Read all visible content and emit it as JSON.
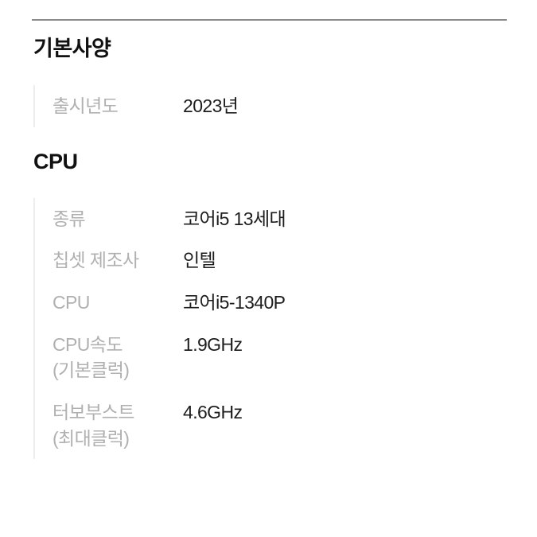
{
  "divider": {
    "name": "top-divider",
    "color": "#8a8a8a"
  },
  "colors": {
    "background": "#ffffff",
    "heading": "#111111",
    "label": "#b0b0b0",
    "value": "#1d1d1d",
    "rule": "#ededed"
  },
  "sections": [
    {
      "title": "기본사양",
      "rows": [
        {
          "label": "출시년도",
          "value": "2023년"
        }
      ]
    },
    {
      "title": "CPU",
      "rows": [
        {
          "label": "종류",
          "value": "코어i5 13세대"
        },
        {
          "label": "칩셋 제조사",
          "value": "인텔"
        },
        {
          "label": "CPU",
          "value": "코어i5-1340P"
        },
        {
          "label": "CPU속도(기본클럭)",
          "value": "1.9GHz"
        },
        {
          "label": "터보부스트(최대클럭)",
          "value": "4.6GHz"
        }
      ]
    }
  ]
}
